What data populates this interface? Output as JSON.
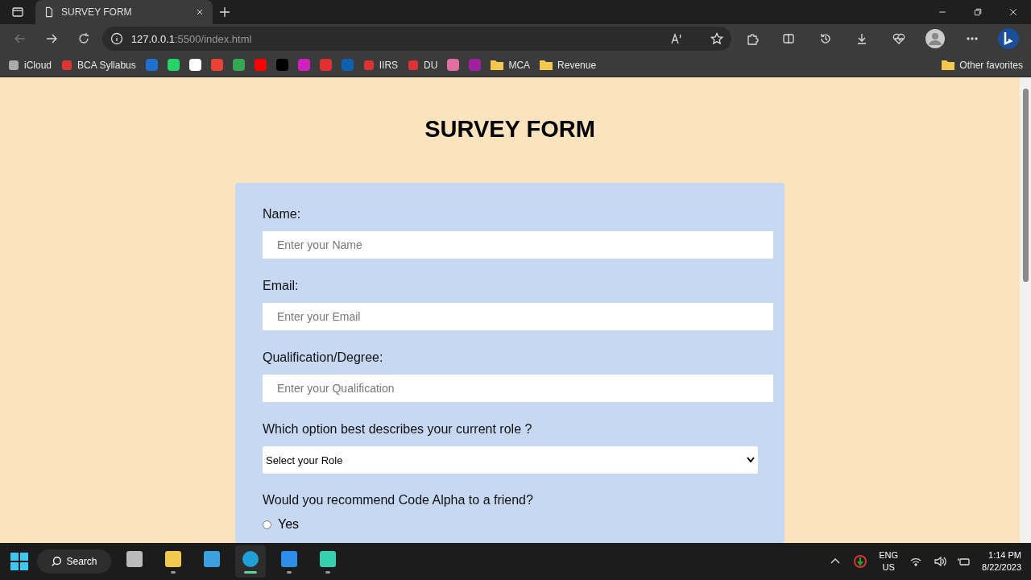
{
  "tab": {
    "title": "SURVEY FORM"
  },
  "address": {
    "host": "127.0.0.1",
    "path": ":5500/index.html"
  },
  "bookmarks": [
    {
      "kind": "link",
      "label": "iCloud"
    },
    {
      "kind": "link",
      "label": "BCA Syllabus"
    },
    {
      "kind": "icon"
    },
    {
      "kind": "icon"
    },
    {
      "kind": "icon"
    },
    {
      "kind": "icon"
    },
    {
      "kind": "icon"
    },
    {
      "kind": "icon"
    },
    {
      "kind": "icon"
    },
    {
      "kind": "icon"
    },
    {
      "kind": "icon"
    },
    {
      "kind": "icon"
    },
    {
      "kind": "link",
      "label": "IIRS"
    },
    {
      "kind": "link",
      "label": "DU"
    },
    {
      "kind": "icon"
    },
    {
      "kind": "icon"
    },
    {
      "kind": "folder",
      "label": "MCA"
    },
    {
      "kind": "folder",
      "label": "Revenue"
    }
  ],
  "other_favorites": "Other favorites",
  "page": {
    "heading": "SURVEY FORM",
    "fields": [
      {
        "kind": "text",
        "label": "Name:",
        "placeholder": "Enter your Name"
      },
      {
        "kind": "text",
        "label": "Email:",
        "placeholder": "Enter your Email"
      },
      {
        "kind": "text",
        "label": "Qualification/Degree:",
        "placeholder": "Enter your Qualification"
      },
      {
        "kind": "select",
        "label": "Which option best describes your current role ?",
        "value": "Select your Role"
      },
      {
        "kind": "radio",
        "label": "Would you recommend Code Alpha to a friend?",
        "options": [
          {
            "label": "Yes",
            "selected": false
          }
        ]
      }
    ]
  },
  "taskbar": {
    "search": "Search",
    "apps": [
      {
        "running": false,
        "selected": false
      },
      {
        "running": true,
        "selected": false
      },
      {
        "running": false,
        "selected": false
      },
      {
        "running": true,
        "selected": true
      },
      {
        "running": true,
        "selected": false
      },
      {
        "running": true,
        "selected": false
      }
    ],
    "language": "ENG",
    "region": "US",
    "time": "1:14 PM",
    "date": "8/22/2023"
  }
}
